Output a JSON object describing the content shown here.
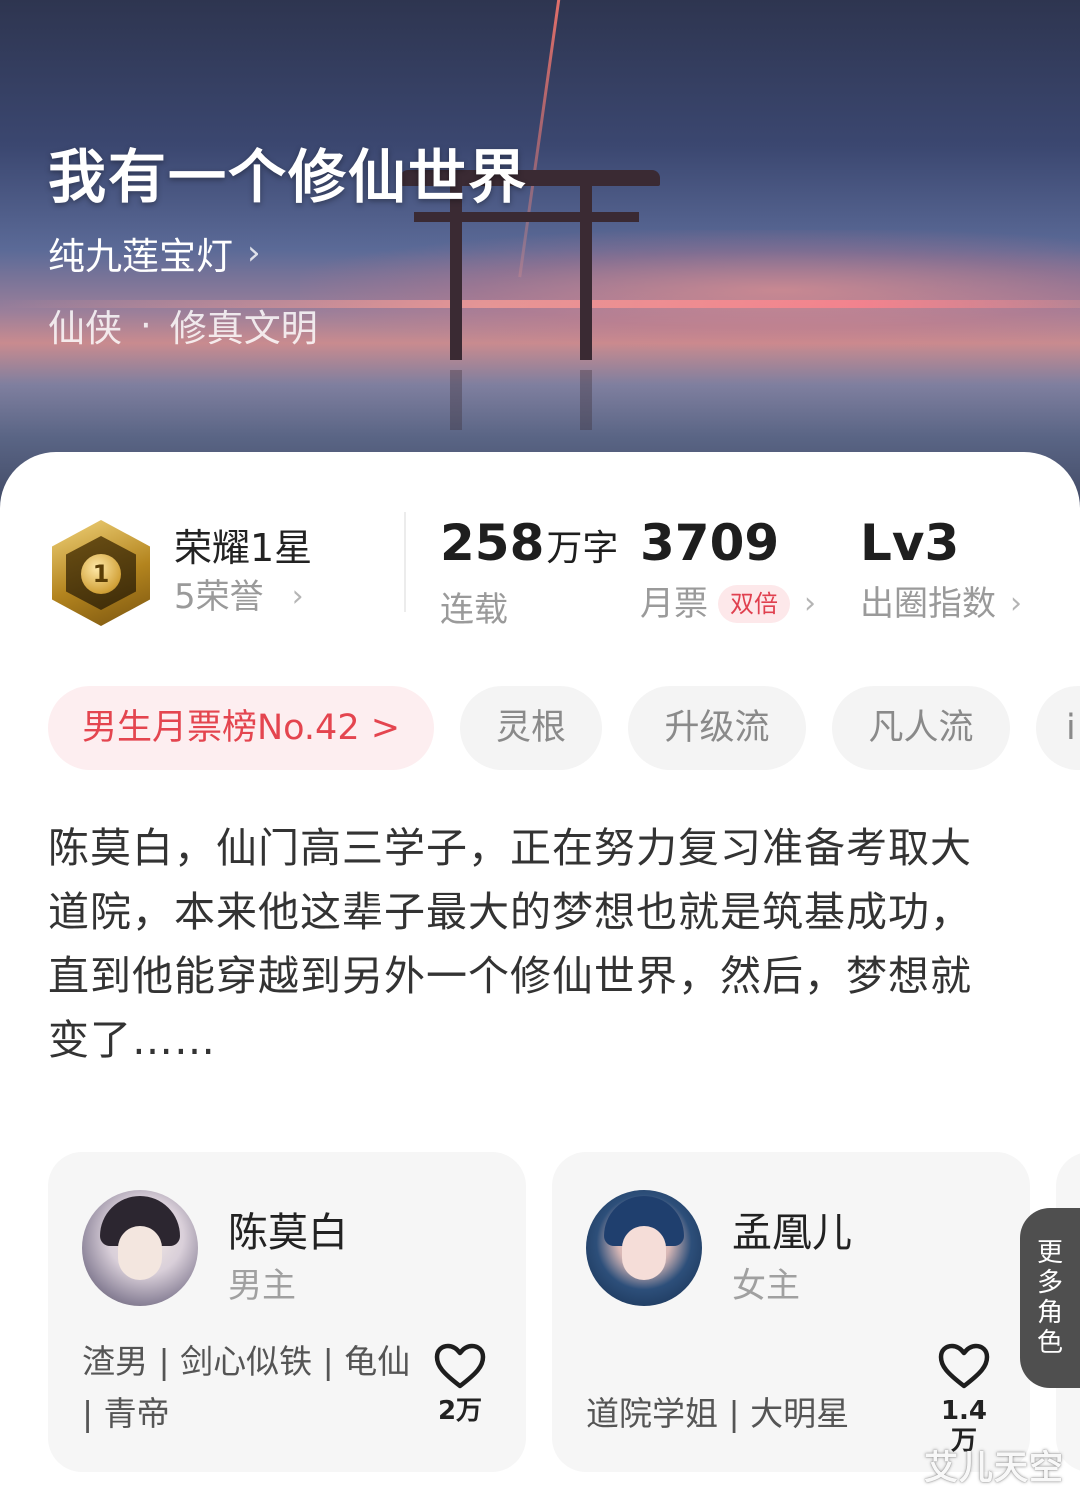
{
  "book": {
    "title": "我有一个修仙世界",
    "author": "纯九莲宝灯",
    "genre_main": "仙侠",
    "genre_sep": "·",
    "genre_sub": "修真文明"
  },
  "honor": {
    "level": "荣耀1星",
    "medal_number": "1",
    "count": "5荣誉"
  },
  "stats": {
    "words_value": "258",
    "words_unit": "万字",
    "words_label": "连载",
    "tickets_value": "3709",
    "tickets_label": "月票",
    "tickets_badge": "双倍",
    "index_value": "Lv3",
    "index_label": "出圈指数"
  },
  "tags": [
    "男生月票榜No.42 >",
    "灵根",
    "升级流",
    "凡人流",
    "i"
  ],
  "synopsis": "陈莫白，仙门高三学子，正在努力复习准备考取大道院，本来他这辈子最大的梦想也就是筑基成功，直到他能穿越到另外一个修仙世界，然后，梦想就变了……",
  "characters": [
    {
      "name": "陈莫白",
      "role": "男主",
      "tags": "渣男 | 剑心似铁 | 龟仙 | 青帝",
      "likes": "2万"
    },
    {
      "name": "孟凰儿",
      "role": "女主",
      "tags": "道院学姐 | 大明星",
      "likes": "1.4万"
    }
  ],
  "more_roles": [
    "更",
    "多",
    "角",
    "色"
  ],
  "watermark": "艾儿天空",
  "icons": {
    "chevron": "chevron-right-icon",
    "heart": "heart-outline-icon",
    "medal": "honor-medal-icon"
  },
  "colors": {
    "accent_red": "#e4454f",
    "rank_tag_bg": "#fdeef0"
  }
}
